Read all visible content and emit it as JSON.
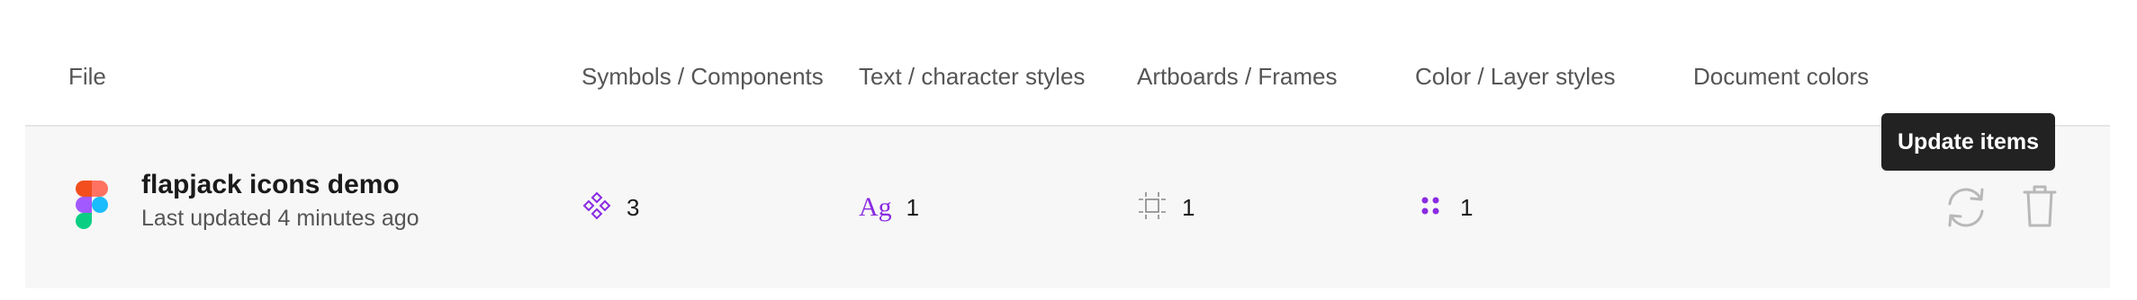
{
  "columns": {
    "file": "File",
    "symbols": "Symbols / Components",
    "text_styles": "Text / character styles",
    "artboards": "Artboards / Frames",
    "layer_styles": "Color / Layer styles",
    "document_colors": "Document colors"
  },
  "file": {
    "icon": "figma-logo-icon",
    "name": "flapjack icons demo",
    "last_updated": "Last updated 4 minutes ago",
    "symbols_count": "3",
    "text_styles_icon_text": "Ag",
    "text_styles_count": "1",
    "artboards_count": "1",
    "layer_styles_count": "1"
  },
  "tooltip": {
    "text": "Update items"
  },
  "actions": {
    "update_icon": "refresh-icon",
    "delete_icon": "trash-icon"
  },
  "colors": {
    "accent_purple": "#8a2be2",
    "row_background": "#f7f7f7",
    "tooltip_background": "#222222"
  }
}
